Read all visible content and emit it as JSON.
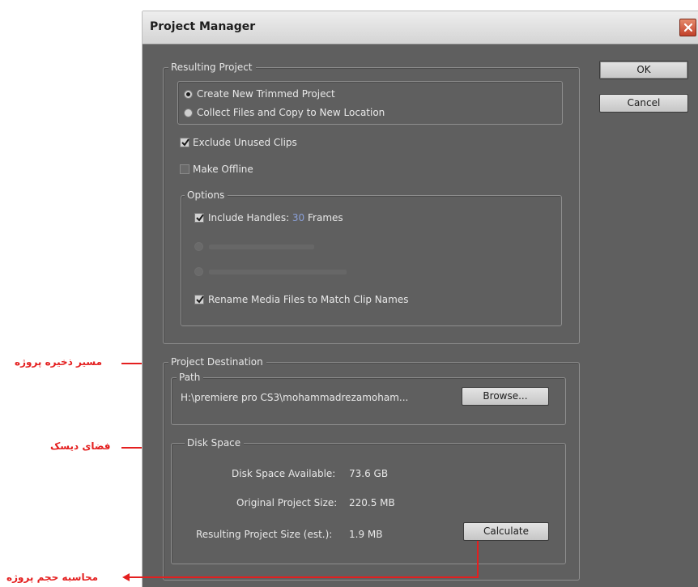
{
  "window": {
    "title": "Project Manager"
  },
  "buttons": {
    "ok": "OK",
    "cancel": "Cancel",
    "browse": "Browse...",
    "calculate": "Calculate"
  },
  "resulting_project": {
    "legend": "Resulting Project",
    "options": [
      {
        "label": "Create New Trimmed Project",
        "selected": true
      },
      {
        "label": "Collect Files and Copy to New Location",
        "selected": false
      }
    ]
  },
  "checks": {
    "exclude_unused": {
      "label": "Exclude Unused Clips",
      "checked": true
    },
    "make_offline": {
      "label": "Make Offline",
      "checked": false
    }
  },
  "options_group": {
    "legend": "Options",
    "include_handles_prefix": "Include Handles: ",
    "handles_value": "30",
    "handles_suffix": " Frames",
    "include_handles_checked": true,
    "rename_media": {
      "label": "Rename Media Files to Match Clip Names",
      "checked": true
    }
  },
  "destination": {
    "legend": "Project Destination",
    "path_legend": "Path",
    "path_value": "H:\\premiere pro CS3\\mohammadrezamoham..."
  },
  "disk_space": {
    "legend": "Disk Space",
    "available_label": "Disk Space Available:",
    "available_value": "73.6 GB",
    "original_label": "Original Project Size:",
    "original_value": "220.5 MB",
    "resulting_label": "Resulting Project Size (est.):",
    "resulting_value": "1.9 MB"
  },
  "annotations": {
    "destination_note": "مسیر ذخیره پروژه",
    "disk_space_note": "فضای دیسک",
    "calculate_note": "محاسبه حجم پروژه",
    "color": "#e41f1f"
  },
  "colors": {
    "dialog_bg": "#5f5f5f",
    "titlebar": "#e2e2e2",
    "close_button": "#c9462e"
  }
}
